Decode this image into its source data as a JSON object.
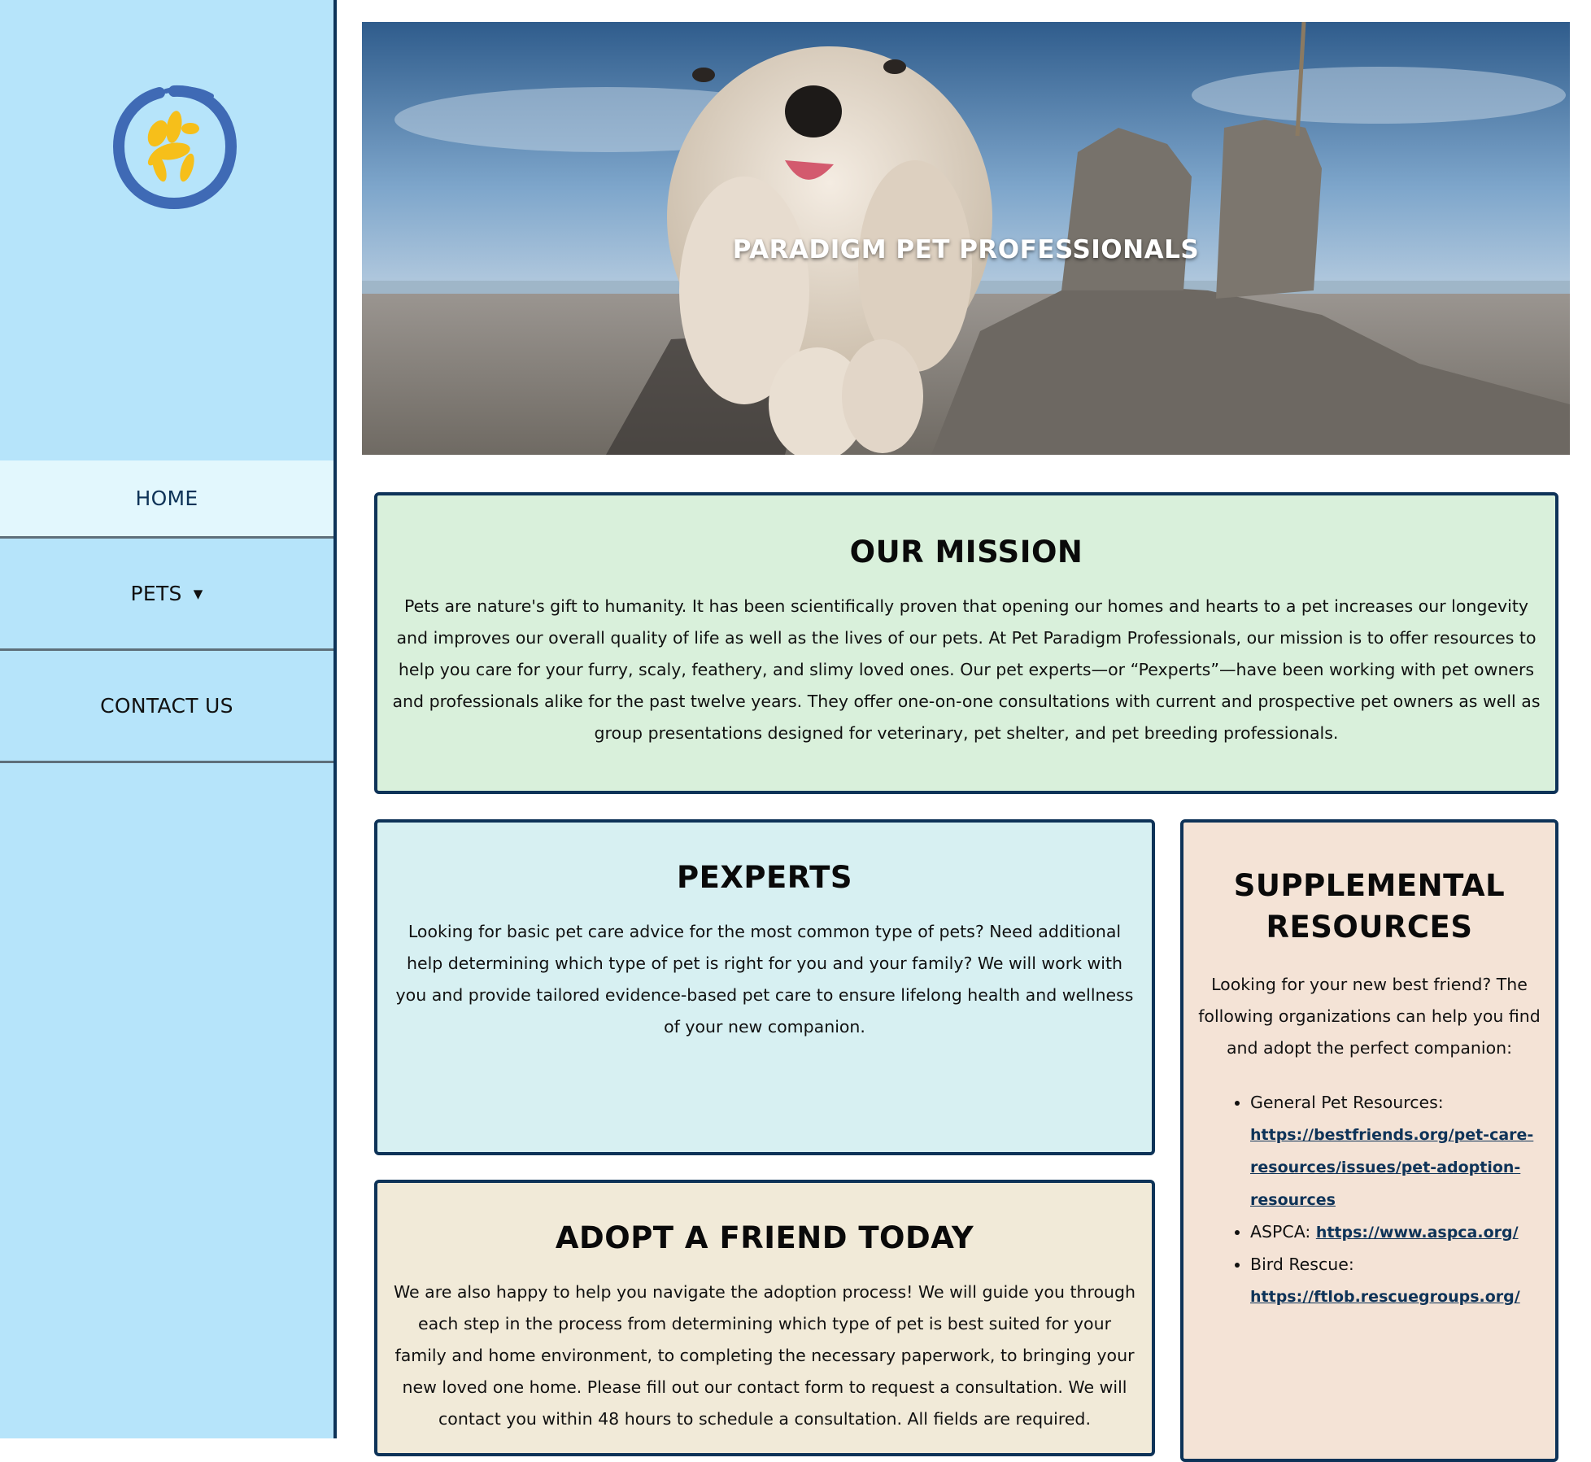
{
  "site": {
    "title": "PARADIGM PET PROFESSIONALS",
    "logo_icon": "balloon-dog-logo-icon"
  },
  "nav": {
    "items": [
      {
        "label": "HOME",
        "active": true
      },
      {
        "label": "PETS",
        "has_dropdown": true,
        "dropdown_icon": "caret-down-icon"
      },
      {
        "label": "CONTACT US"
      }
    ]
  },
  "mission": {
    "heading": "OUR MISSION",
    "text": "Pets are nature's gift to humanity. It has been scientifically proven that opening our homes and hearts to a pet increases our longevity and improves our overall quality of life as well as the lives of our pets. At Pet Paradigm Professionals, our mission is to offer resources to help you care for your furry, scaly, feathery, and slimy loved ones. Our pet experts—or “Pexperts”—have been working with pet owners and professionals alike for the past twelve years. They offer one-on-one consultations with current and prospective pet owners as well as group presentations designed for veterinary, pet shelter, and pet breeding professionals."
  },
  "pexperts": {
    "heading": "PEXPERTS",
    "text": "Looking for basic pet care advice for the most common type of pets? Need additional help determining which type of pet is right for you and your family? We will work with you and provide tailored evidence-based pet care to ensure lifelong health and wellness of your new companion."
  },
  "adopt": {
    "heading": "ADOPT A FRIEND TODAY",
    "text": "We are also happy to help you navigate the adoption process! We will guide you through each step in the process from determining which type of pet is best suited for your family and home environment, to completing the necessary paperwork, to bringing your new loved one home. Please fill out our contact form to request a consultation. We will contact you within 48 hours to schedule a consultation. All fields are required."
  },
  "supplemental": {
    "heading": "SUPPLEMENTAL RESOURCES",
    "text": "Looking for your new best friend? The following organizations can help you find and adopt the perfect companion:",
    "links": [
      {
        "label": "General Pet Resources:",
        "url": "https://bestfriends.org/pet-care-resources/issues/pet-adoption-resources"
      },
      {
        "label": "ASPCA:",
        "url": "https://www.aspca.org/"
      },
      {
        "label": "Bird Rescue:",
        "url": "https://ftlob.rescuegroups.org/"
      }
    ]
  },
  "colors": {
    "sidebar_bg": "#b6e4fa",
    "border": "#0e3358",
    "mission_bg": "#d9f0db",
    "pexperts_bg": "#d7f0f2",
    "adopt_bg": "#f1ead8",
    "supplemental_bg": "#f4e3d6",
    "logo_ring": "#3f6ab5",
    "logo_dog": "#f6bf1a"
  }
}
